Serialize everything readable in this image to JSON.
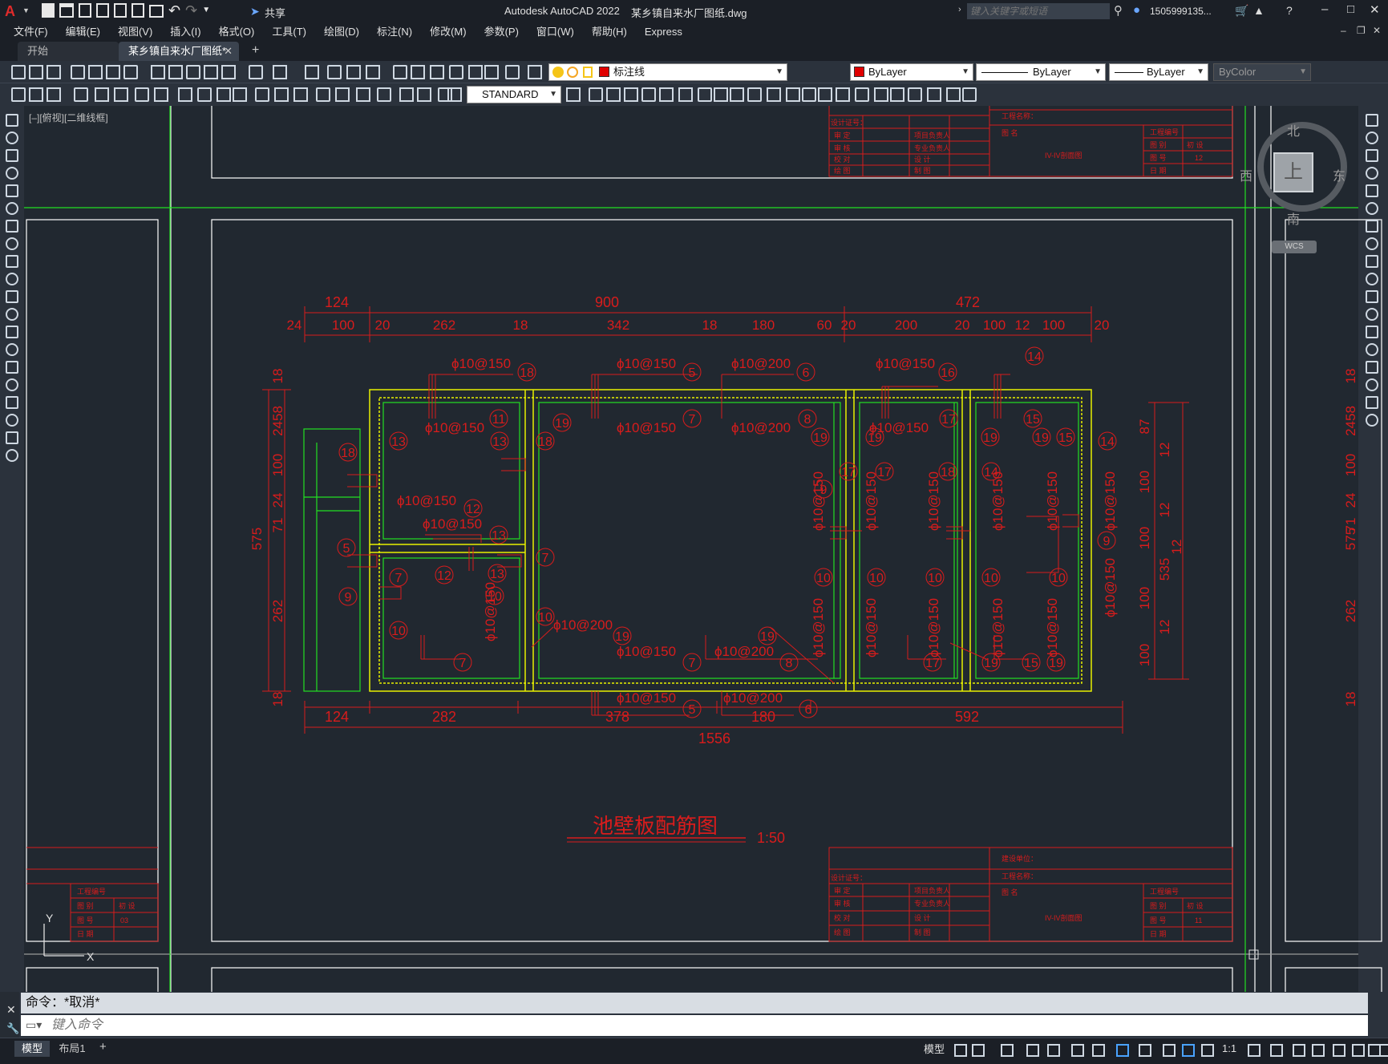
{
  "app": {
    "title": "Autodesk AutoCAD 2022",
    "filename": "某乡镇自来水厂图纸.dwg",
    "logo": "A",
    "share_label": "共享",
    "search_placeholder": "键入关键字或短语",
    "user": "1505999135...",
    "window_buttons": [
      "–",
      "□",
      "✕"
    ]
  },
  "menu": [
    "文件(F)",
    "编辑(E)",
    "视图(V)",
    "插入(I)",
    "格式(O)",
    "工具(T)",
    "绘图(D)",
    "标注(N)",
    "修改(M)",
    "参数(P)",
    "窗口(W)",
    "帮助(H)",
    "Express"
  ],
  "tabs": [
    {
      "label": "开始",
      "active": false
    },
    {
      "label": "某乡镇自来水厂图纸*",
      "active": true
    }
  ],
  "toolbar": {
    "layer_name": "标注线",
    "color": "ByLayer",
    "linetype": "ByLayer",
    "lineweight": "ByLayer",
    "plotstyle": "ByColor",
    "textstyle": "STANDARD"
  },
  "viewport": {
    "label": "[–][俯视][二维线框]",
    "viewcube": {
      "top": "上",
      "north": "北",
      "south": "南",
      "west": "西",
      "east": "东",
      "ucs": "WCS"
    }
  },
  "drawing": {
    "title": "池壁板配筋图",
    "scale": "1:50",
    "dims_top_row1": [
      "124",
      "900",
      "472"
    ],
    "dims_top_row2": [
      "24",
      "100",
      "20",
      "262",
      "18",
      "342",
      "18",
      "180",
      "60",
      "20",
      "200",
      "20",
      "100",
      "12",
      "100",
      "20"
    ],
    "dims_bottom": [
      "124",
      "282",
      "378",
      "180",
      "592"
    ],
    "dim_total": "1556",
    "dims_left": [
      "18",
      "2458",
      "100",
      "24",
      "71",
      "575",
      "262",
      "18"
    ],
    "dims_right": [
      "87",
      "12",
      "100",
      "12",
      "100",
      "12",
      "535",
      "100",
      "12",
      "100"
    ],
    "rebar_labels": [
      "ϕ10@150",
      "ϕ10@200"
    ],
    "title_block": {
      "build_unit": "建设单位：",
      "project_name": "工程名称：",
      "drawing_name_label": "图  名",
      "drawing_name": "IV-IV剖面图",
      "project_no": "工程编号",
      "rows_left": [
        "设计证号：",
        "审    定",
        "审    核",
        "校    对",
        "绘    图"
      ],
      "rows_mid": [
        "项目负责人",
        "专业负责人",
        "设    计",
        "制    图"
      ],
      "rows_right": [
        "图    别",
        "图    号",
        "日    期"
      ],
      "stage": "初    设",
      "sheet_top": "12",
      "sheet_bottom": "11",
      "sheet_left": "03"
    }
  },
  "command": {
    "history": "命令：*取消*",
    "placeholder": "键入命令"
  },
  "status": {
    "layout_tabs": [
      "模型",
      "布局1"
    ],
    "model_label": "模型",
    "scale": "1:1"
  }
}
